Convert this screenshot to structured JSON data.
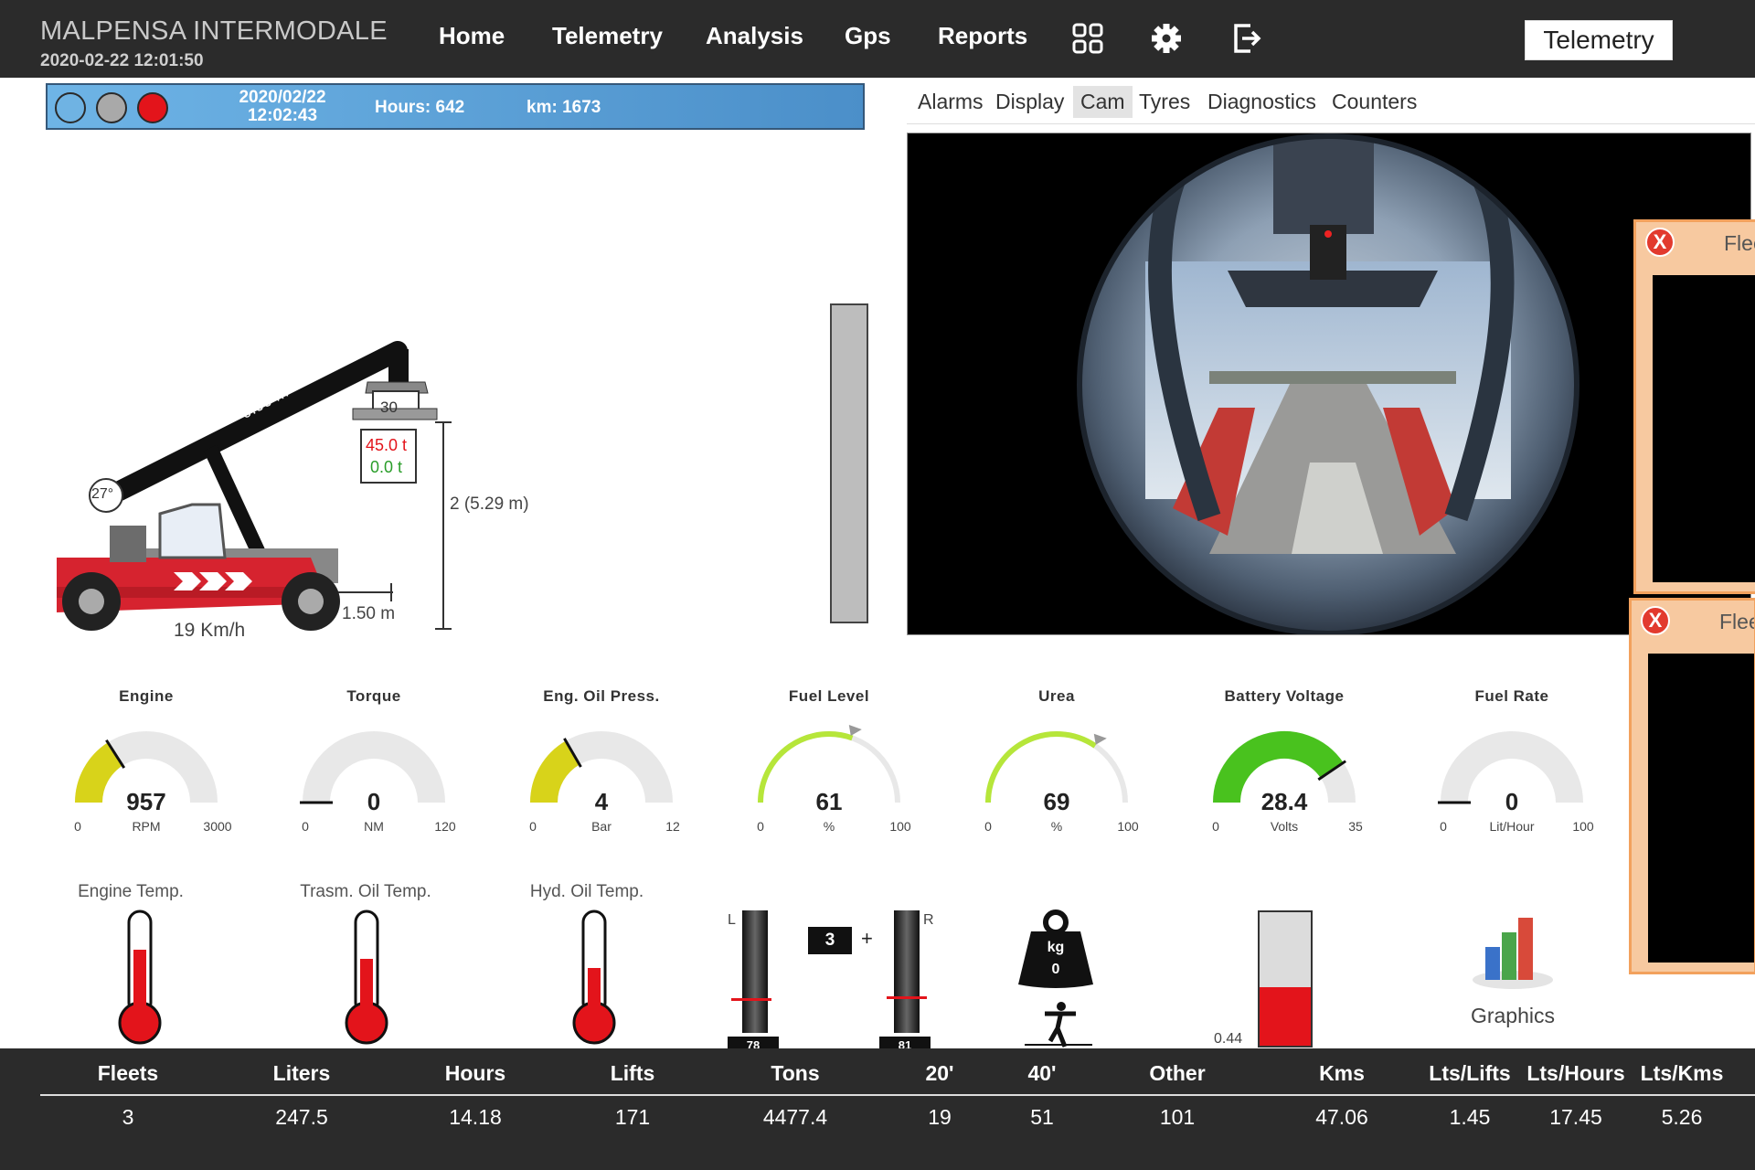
{
  "header": {
    "title": "MALPENSA INTERMODALE",
    "datetime": "2020-02-22 12:01:50",
    "nav": [
      "Home",
      "Telemetry",
      "Analysis",
      "Gps",
      "Reports"
    ],
    "icons": [
      "grid-icon",
      "gear-icon",
      "logout-icon"
    ],
    "mode_button": "Telemetry"
  },
  "status": {
    "lights": [
      "#6fb3e3",
      "#a9a9a9",
      "#e3141b"
    ],
    "date": "2020/02/22",
    "time": "12:02:43",
    "hours": "Hours: 642",
    "km": "km: 1673"
  },
  "tabs": {
    "items": [
      "Alarms",
      "Display",
      "Cam",
      "Tyres",
      "Diagnostics",
      "Counters"
    ],
    "active": "Cam"
  },
  "fleet_panels": [
    {
      "title": "Flee",
      "close": "X"
    },
    {
      "title": "Flee",
      "close": "X"
    }
  ],
  "machine": {
    "boom_length": "9.00 m",
    "angle": "27°",
    "load_code": "30",
    "capacity": "45.0 t",
    "load": "0.0 t",
    "height": "2 (5.29 m)",
    "distance": "1.50 m",
    "speed": "19 Km/h"
  },
  "gauges": [
    {
      "title": "Engine",
      "value": "957",
      "unit": "RPM",
      "min": "0",
      "max": "3000",
      "fraction": 0.319,
      "color": "#d8d31a"
    },
    {
      "title": "Torque",
      "value": "0",
      "unit": "NM",
      "min": "0",
      "max": "120",
      "fraction": 0.0,
      "color": "#d8d31a"
    },
    {
      "title": "Eng. Oil Press.",
      "value": "4",
      "unit": "Bar",
      "min": "0",
      "max": "12",
      "fraction": 0.333,
      "color": "#d8d31a"
    },
    {
      "title": "Fuel Level",
      "value": "61",
      "unit": "%",
      "min": "0",
      "max": "100",
      "fraction": 0.61,
      "color": "#b6e63a",
      "thin": true
    },
    {
      "title": "Urea",
      "value": "69",
      "unit": "%",
      "min": "0",
      "max": "100",
      "fraction": 0.69,
      "color": "#b6e63a",
      "thin": true
    },
    {
      "title": "Battery Voltage",
      "value": "28.4",
      "unit": "Volts",
      "min": "0",
      "max": "35",
      "fraction": 0.811,
      "color": "#49c21e"
    },
    {
      "title": "Fuel Rate",
      "value": "0",
      "unit": "Lit/Hour",
      "min": "0",
      "max": "100",
      "fraction": 0.0,
      "color": "#d8d31a"
    }
  ],
  "temperatures": [
    {
      "label": "Engine Temp.",
      "fraction": 0.7
    },
    {
      "label": "Trasm. Oil Temp.",
      "fraction": 0.6
    },
    {
      "label": "Hyd. Oil Temp.",
      "fraction": 0.5
    }
  ],
  "spreader": {
    "left_label": "L",
    "right_label": "R",
    "count": "3",
    "plus": "+",
    "left_value": "78",
    "right_value": "81"
  },
  "weight": {
    "unit": "kg",
    "value": "0"
  },
  "level": {
    "value": "0.44",
    "fraction": 0.44
  },
  "graphics": {
    "label": "Graphics"
  },
  "stats": {
    "headers": [
      "Fleets",
      "Liters",
      "Hours",
      "Lifts",
      "Tons",
      "20'",
      "40'",
      "Other",
      "Kms",
      "Lts/Lifts",
      "Lts/Hours",
      "Lts/Kms"
    ],
    "values": [
      "3",
      "247.5",
      "14.18",
      "171",
      "4477.4",
      "19",
      "51",
      "101",
      "47.06",
      "1.45",
      "17.45",
      "5.26"
    ]
  }
}
